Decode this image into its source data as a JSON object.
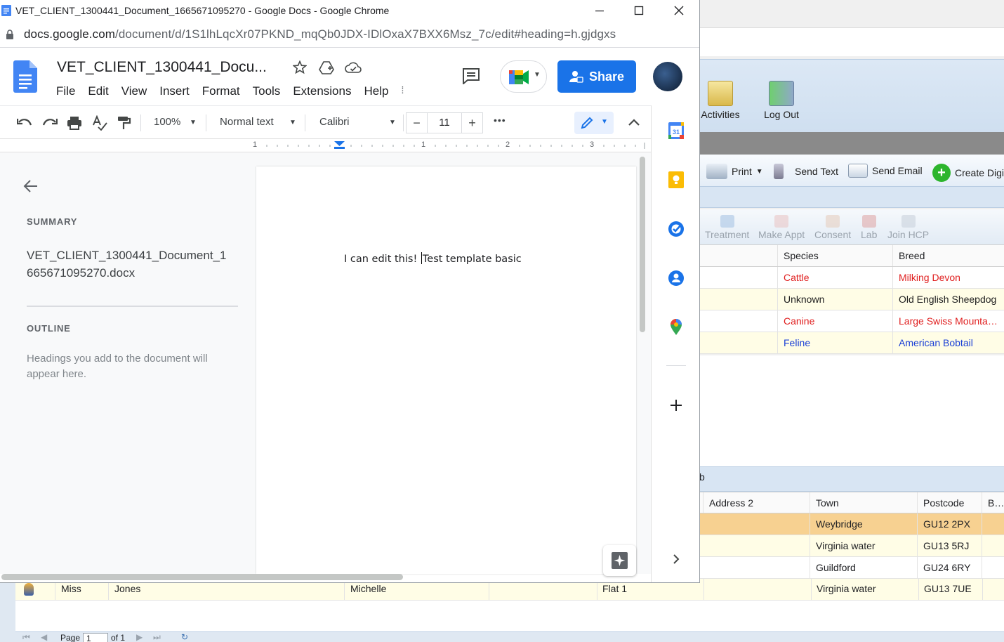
{
  "chrome": {
    "window_title": "VET_CLIENT_1300441_Document_1665671095270 - Google Docs - Google Chrome",
    "url_host": "docs.google.com",
    "url_path": "/document/d/1S1lhLqcXr07PKND_mqQb0JDX-IDlOxaX7BXX6Msz_7c/edit#heading=h.gjdgxs"
  },
  "docs": {
    "title": "VET_CLIENT_1300441_Docu...",
    "menu": [
      "File",
      "Edit",
      "View",
      "Insert",
      "Format",
      "Tools",
      "Extensions",
      "Help"
    ],
    "menu_extra": "⁞",
    "share_label": "Share",
    "toolbar": {
      "zoom": "100%",
      "style": "Normal text",
      "font": "Calibri",
      "font_size": "11",
      "more": "•••"
    },
    "ruler_marks": [
      "1",
      "1",
      "2",
      "3"
    ],
    "outline": {
      "summary_label": "SUMMARY",
      "file_name": "VET_CLIENT_1300441_Document_1665671095270.docx",
      "outline_label": "OUTLINE",
      "hint": "Headings you add to the document will appear here."
    },
    "page_text_before": "I can edit this! ",
    "page_text_after": "Test template basic",
    "side_panel_icons": [
      "calendar-icon",
      "keep-icon",
      "tasks-icon",
      "contacts-icon",
      "maps-icon"
    ]
  },
  "vet_app": {
    "ribbon": {
      "activities_label": "Activities",
      "logout_label": "Log Out"
    },
    "actions": {
      "print": "Print",
      "send_text": "Send Text",
      "send_email": "Send Email",
      "create": "Create Digi"
    },
    "sub_actions": [
      "Treatment",
      "Make Appt",
      "Consent",
      "Lab",
      "Join HCP"
    ],
    "pets_grid": {
      "headers": [
        "Species",
        "Breed"
      ],
      "rows": [
        {
          "species": "Cattle",
          "breed": "Milking Devon",
          "color": "#e02020"
        },
        {
          "species": "Unknown",
          "breed": "Old English Sheepdog",
          "color": "#202020"
        },
        {
          "species": "Canine",
          "breed": "Large Swiss Mountain...",
          "color": "#e02020"
        },
        {
          "species": "Feline",
          "breed": "American Bobtail",
          "color": "#1a3fd6"
        }
      ]
    },
    "band_glyph": "b",
    "clients_grid": {
      "headers": [
        "Address 2",
        "Town",
        "Postcode",
        "Bus"
      ],
      "rows": [
        {
          "town": "Weybridge",
          "postcode": "GU12 2PX"
        },
        {
          "town": "Virginia water",
          "postcode": "GU13 5RJ"
        },
        {
          "town": "Guildford",
          "postcode": "GU24 6RY"
        },
        {
          "town": "Virginia water",
          "postcode": "GU13 7UE"
        }
      ]
    },
    "last_row": {
      "title": "Miss",
      "surname": "Jones",
      "forename": "Michelle",
      "address1": "Flat 1"
    },
    "pager": {
      "page_label": "Page",
      "page_value": "1",
      "of_label": "of 1"
    }
  }
}
